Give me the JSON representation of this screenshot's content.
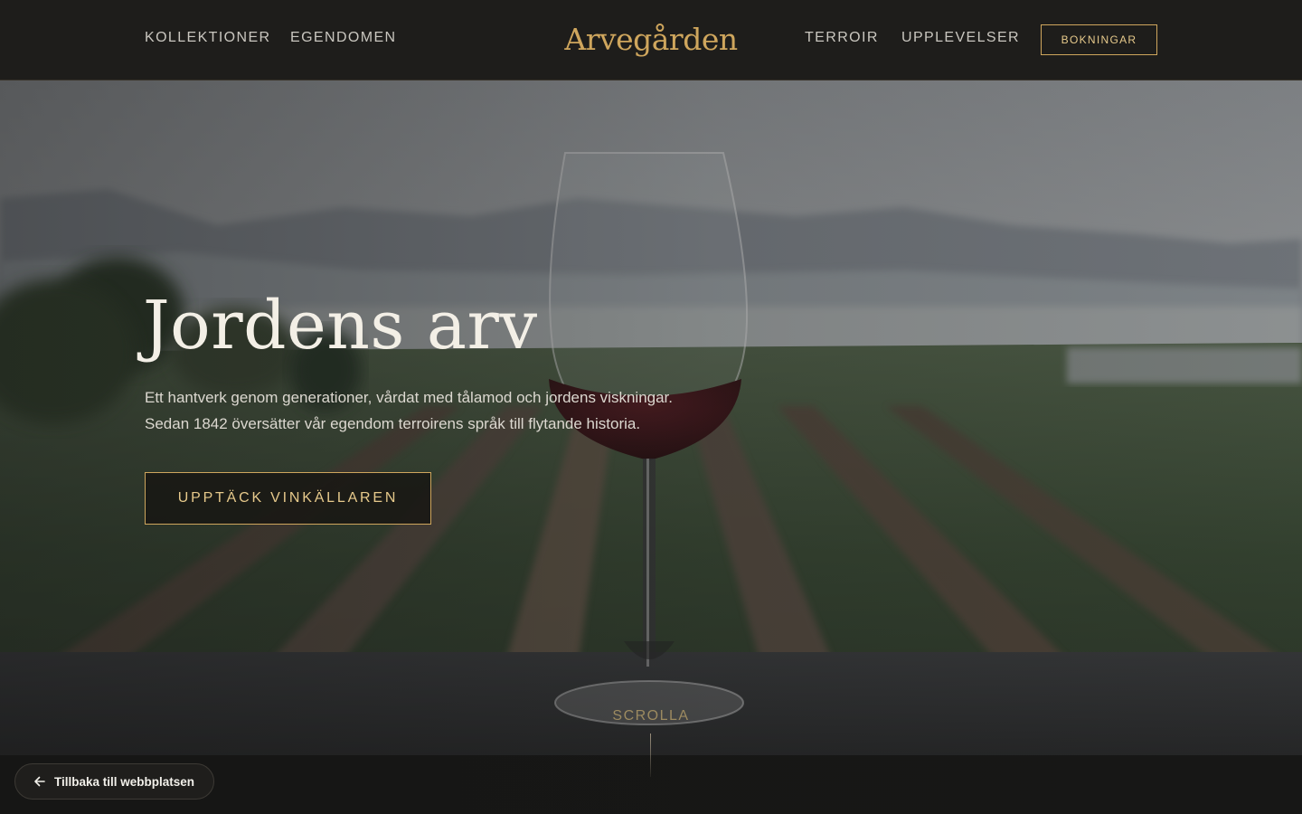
{
  "header": {
    "nav_left": [
      "KOLLEKTIONER",
      "EGENDOMEN"
    ],
    "logo": "Arvegården",
    "nav_right": [
      "TERROIR",
      "UPPLEVELSER"
    ],
    "booking_label": "BOKNINGAR"
  },
  "hero": {
    "title": "Jordens arv",
    "lines": [
      "Ett hantverk genom generationer, vårdat med tålamod och jordens viskningar.",
      "Sedan 1842 översätter vår egendom terroirens språk till flytande historia."
    ],
    "cta_label": "UPPTÄCK VINKÄLLAREN",
    "scroll_label": "SCROLLA"
  },
  "back_link": {
    "label": "Tillbaka till webbplatsen",
    "icon": "arrow-left-icon"
  },
  "colors": {
    "accent_gold": "#cfa65d",
    "header_bg": "#1e1d1b",
    "text_light": "#f3efe6"
  }
}
